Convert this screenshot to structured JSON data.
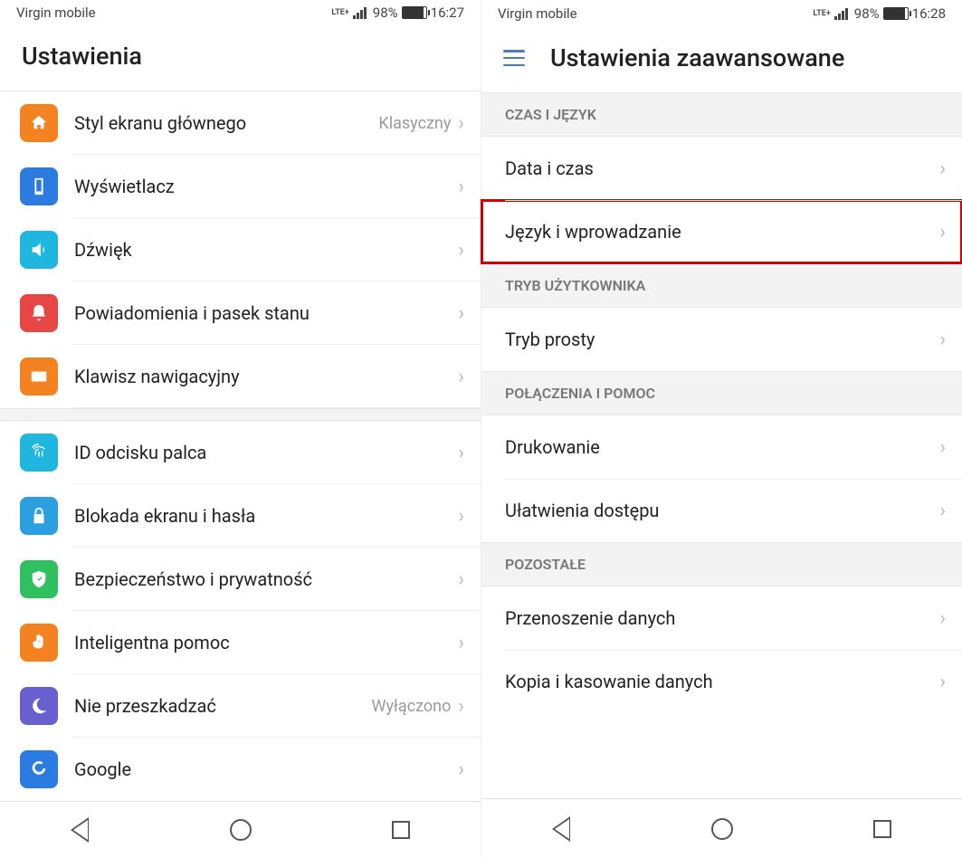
{
  "left": {
    "status": {
      "carrier": "Virgin mobile",
      "lte_label": "LTE+",
      "battery": "98%",
      "time": "16:27"
    },
    "title": "Ustawienia",
    "groups": [
      {
        "rows": [
          {
            "id": "homestyle",
            "icon": "home-icon",
            "color": "ic-home",
            "label": "Styl ekranu głównego",
            "value": "Klasyczny"
          },
          {
            "id": "display",
            "icon": "display-icon",
            "color": "ic-disp",
            "label": "Wyświetlacz",
            "value": ""
          },
          {
            "id": "sound",
            "icon": "sound-icon",
            "color": "ic-snd",
            "label": "Dźwięk",
            "value": ""
          },
          {
            "id": "notif",
            "icon": "bell-icon",
            "color": "ic-notif",
            "label": "Powiadomienia i pasek stanu",
            "value": ""
          },
          {
            "id": "navkey",
            "icon": "keyboard-icon",
            "color": "ic-nav",
            "label": "Klawisz nawigacyjny",
            "value": ""
          }
        ]
      },
      {
        "rows": [
          {
            "id": "finger",
            "icon": "fingerprint-icon",
            "color": "ic-finger",
            "label": "ID odcisku palca",
            "value": ""
          },
          {
            "id": "lock",
            "icon": "lock-icon",
            "color": "ic-lock",
            "label": "Blokada ekranu i hasła",
            "value": ""
          },
          {
            "id": "security",
            "icon": "shield-icon",
            "color": "ic-sec",
            "label": "Bezpieczeństwo i prywatność",
            "value": ""
          },
          {
            "id": "smart",
            "icon": "hand-icon",
            "color": "ic-smart",
            "label": "Inteligentna pomoc",
            "value": ""
          },
          {
            "id": "dnd",
            "icon": "moon-icon",
            "color": "ic-dnd",
            "label": "Nie przeszkadzać",
            "value": "Wyłączono"
          },
          {
            "id": "google",
            "icon": "google-icon",
            "color": "ic-goog",
            "label": "Google",
            "value": ""
          }
        ]
      }
    ]
  },
  "right": {
    "status": {
      "carrier": "Virgin mobile",
      "lte_label": "LTE+",
      "battery": "98%",
      "time": "16:28"
    },
    "title": "Ustawienia zaawansowane",
    "sections": [
      {
        "header": "CZAS I JĘZYK",
        "rows": [
          {
            "id": "datetime",
            "label": "Data i czas",
            "highlight": false
          },
          {
            "id": "lang",
            "label": "Język i wprowadzanie",
            "highlight": true
          }
        ]
      },
      {
        "header": "TRYB UŻYTKOWNIKA",
        "rows": [
          {
            "id": "simple",
            "label": "Tryb prosty",
            "highlight": false
          }
        ]
      },
      {
        "header": "POŁĄCZENIA I POMOC",
        "rows": [
          {
            "id": "print",
            "label": "Drukowanie",
            "highlight": false
          },
          {
            "id": "access",
            "label": "Ułatwienia dostępu",
            "highlight": false
          }
        ]
      },
      {
        "header": "POZOSTAŁE",
        "rows": [
          {
            "id": "transfer",
            "label": "Przenoszenie danych",
            "highlight": false
          },
          {
            "id": "backup",
            "label": "Kopia i kasowanie danych",
            "highlight": false
          }
        ]
      }
    ]
  },
  "icons": {
    "home-icon": "<path d='M12 3l9 8h-3v8h-4v-5h-4v5H6v-8H3z'/>",
    "display-icon": "<path d='M7 2h10v20H7z M9 4v14h6V4z'/>",
    "sound-icon": "<path d='M4 9v6h4l6 5V4l-6 5H4z M17 8c2 2 2 6 0 8'/>",
    "bell-icon": "<path d='M12 2a6 6 0 0 0-6 6v5l-2 3h16l-2-3V8a6 6 0 0 0-6-6z M10 19a2 2 0 0 0 4 0z'/>",
    "keyboard-icon": "<path d='M3 6h18v12H3z M5 8h2v2H5z M8 8h2v2H8z M11 8h2v2h-2z M14 8h2v2h-2z M17 8h2v2h-2z M7 14h10v2H7z'/>",
    "fingerprint-icon": "<path d='M12 2a10 10 0 0 0-8 4 M12 5a7 7 0 0 0-6 3 M12 8a4 4 0 0 0-4 4v3 M12 11v6 M16 10v7 M19 8a9 9 0 0 0-7-3' fill='none' stroke='white' stroke-width='1.5'/>",
    "lock-icon": "<path d='M7 10V7a5 5 0 0 1 10 0v3h1v11H6V10h1zm2 0h6V7a3 3 0 0 0-6 0v3z'/>",
    "shield-icon": "<path d='M12 2l8 3v6c0 5-3 9-8 11-5-2-8-6-8-11V5l8-3z M10 12l2 2 4-4-1-1-3 3-1-1z'/>",
    "hand-icon": "<path d='M9 11V4a1 1 0 0 1 2 0v6 M11 10V3a1 1 0 0 1 2 0v7 M13 10V4a1 1 0 0 1 2 0v7 M15 11V6a1 1 0 0 1 2 0v8a5 5 0 0 1-5 5h-2a5 5 0 0 1-5-5v-3l2-1z'/>",
    "moon-icon": "<path d='M14 3a9 9 0 1 0 7 14 7 7 0 0 1-7-14z'/>",
    "google-icon": "<path d='M12 11h8a8 8 0 1 1-3-7l-2 2a5 5 0 1 0 2 5h-5v-3z'/>"
  }
}
